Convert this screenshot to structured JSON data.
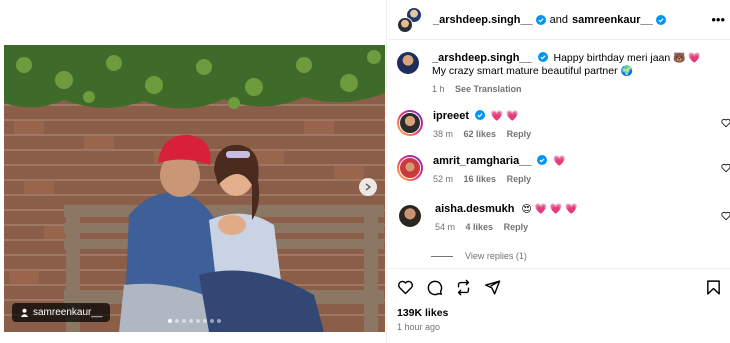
{
  "header": {
    "user1": "_arshdeep.singh__",
    "connector": "and",
    "user2": "samreenkaur__"
  },
  "media": {
    "tag": "samreenkaur__",
    "carousel_total": 8,
    "carousel_active": 1
  },
  "caption": {
    "username": "_arshdeep.singh__",
    "line1": "Happy birthday meri jaan",
    "line1_emoji": "🐻 💗",
    "line2": "My crazy smart mature beautiful partner",
    "line2_emoji": "🌍",
    "time": "1 h",
    "see_translation": "See Translation"
  },
  "comments": [
    {
      "username": "ipreeet",
      "verified": true,
      "text": "💗 💗",
      "time": "38 m",
      "likes": "62 likes",
      "reply": "Reply"
    },
    {
      "username": "amrit_ramgharia__",
      "verified": true,
      "text": "💗",
      "time": "52 m",
      "likes": "16 likes",
      "reply": "Reply"
    },
    {
      "username": "aisha.desmukh",
      "verified": false,
      "text": "😍 💗 💗 💗",
      "time": "54 m",
      "likes": "4 likes",
      "reply": "Reply"
    }
  ],
  "view_replies": "View replies (1)",
  "likes": "139K likes",
  "time_ago": "1 hour ago",
  "colors": {
    "verified": "#0095f6",
    "heart": "#ff3040",
    "muted": "#737373"
  }
}
